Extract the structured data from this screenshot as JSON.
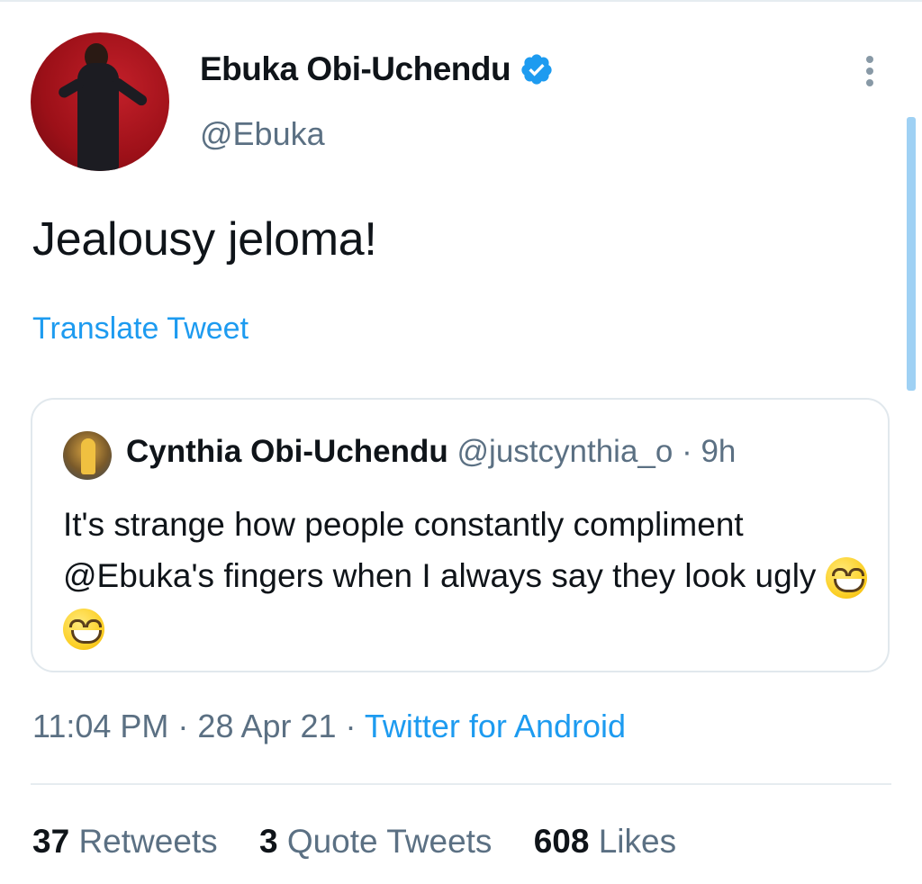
{
  "tweet": {
    "author_name": "Ebuka Obi-Uchendu",
    "author_handle": "@Ebuka",
    "text": "Jealousy jeloma!",
    "translate_label": "Translate Tweet",
    "time": "11:04 PM",
    "date": "28 Apr 21",
    "source": "Twitter for Android",
    "separator": " · "
  },
  "quote": {
    "author_name": "Cynthia Obi-Uchendu",
    "author_handle": "@justcynthia_o",
    "age": "9h",
    "text": "It's strange how people constantly compliment @Ebuka's fingers when I always say they look ugly",
    "emoji": "grinning-squinting-face"
  },
  "stats": {
    "retweets_count": "37",
    "retweets_label": "Retweets",
    "quotes_count": "3",
    "quotes_label": "Quote Tweets",
    "likes_count": "608",
    "likes_label": "Likes"
  },
  "colors": {
    "link": "#1d9bf0",
    "muted": "#5b7083",
    "text": "#0f1419",
    "verified": "#1d9bf0"
  }
}
